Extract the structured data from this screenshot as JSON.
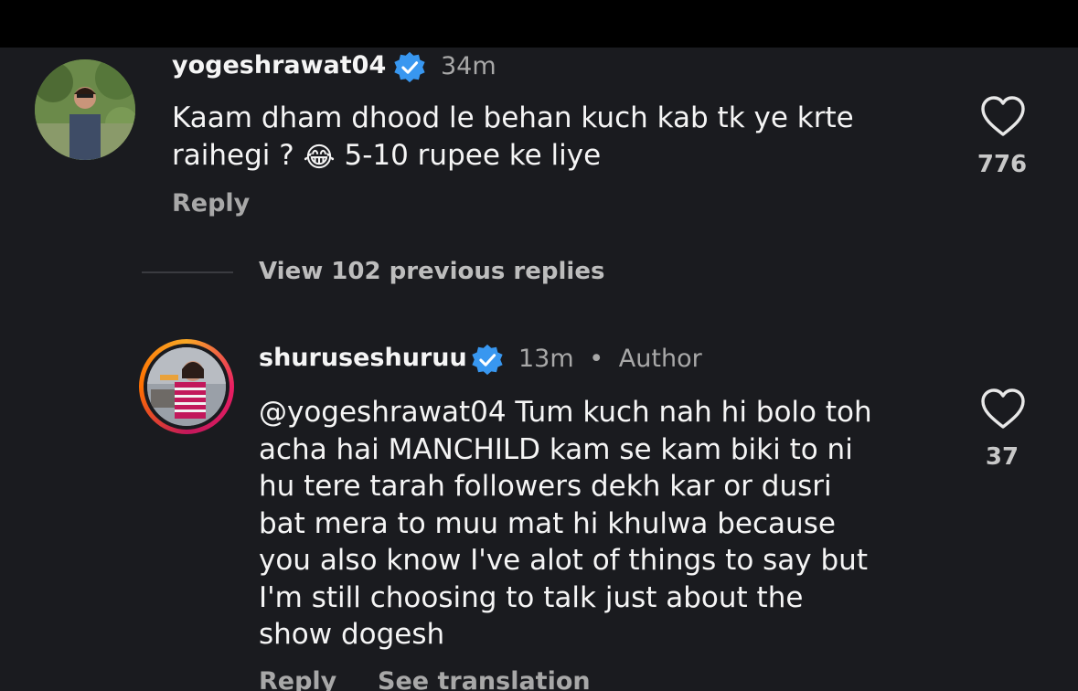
{
  "comments": [
    {
      "username": "yogeshrawat04",
      "time": "34m",
      "text_line1": "Kaam dham dhood le behan kuch kab tk ye krte",
      "text_line2_a": "raihegi ?",
      "emoji": "😂",
      "text_line2_b": "5-10 rupee ke liye",
      "reply_label": "Reply",
      "likes": "776",
      "icons": {
        "verified": "verified-badge-icon",
        "like": "heart-icon"
      }
    },
    {
      "username": "shuruseshuruu",
      "time": "13m",
      "separator": "•",
      "author_label": "Author",
      "lines": [
        "@yogeshrawat04 Tum kuch nah hi bolo toh",
        "acha hai MANCHILD kam se kam biki to ni",
        "hu tere tarah followers dekh kar or dusri",
        "bat mera to muu mat hi khulwa because",
        "you also know I've alot of things to say but",
        "I'm still choosing to talk just about the",
        "show dogesh"
      ],
      "reply_label": "Reply",
      "see_translation_label": "See translation",
      "likes": "37"
    }
  ],
  "thread": {
    "view_replies": "View 102 previous replies"
  },
  "colors": {
    "background": "#1a1b1f",
    "top_bar": "#000000",
    "verified_blue": "#3897f0",
    "secondary_text": "#a8a8a8"
  }
}
